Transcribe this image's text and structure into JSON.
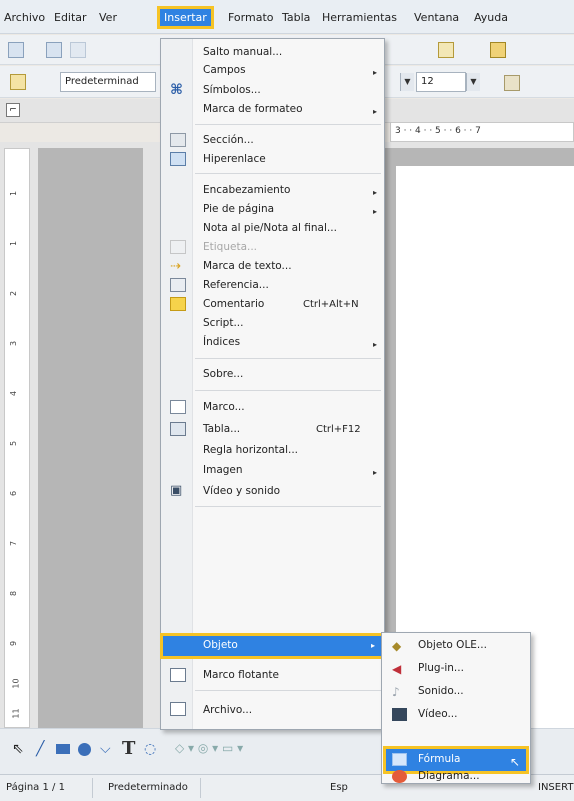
{
  "menubar": {
    "items": [
      "Archivo",
      "Editar",
      "Ver",
      "Insertar",
      "Formato",
      "Tabla",
      "Herramientas",
      "Ventana",
      "Ayuda"
    ]
  },
  "toolbar": {
    "style_value": "Predeterminad",
    "font_size_value": "12"
  },
  "hruler": {
    "text": "3 · · 4 · · 5 · · 6 · · 7"
  },
  "vruler": {
    "marks": [
      "1",
      "1",
      "2",
      "3",
      "4",
      "5",
      "6",
      "7",
      "8",
      "9",
      "10",
      "11"
    ]
  },
  "insert_menu": {
    "items": [
      {
        "label": "Salto manual...",
        "arrow": false
      },
      {
        "label": "Campos",
        "arrow": true
      },
      {
        "label": "Símbolos...",
        "arrow": false
      },
      {
        "label": "Marca de formateo",
        "arrow": true
      },
      {
        "label": "Sección...",
        "arrow": false
      },
      {
        "label": "Hiperenlace",
        "arrow": false
      },
      {
        "label": "Encabezamiento",
        "arrow": true
      },
      {
        "label": "Pie de página",
        "arrow": true
      },
      {
        "label": "Nota al pie/Nota al final...",
        "arrow": false
      },
      {
        "label": "Etiqueta...",
        "arrow": false,
        "disabled": true
      },
      {
        "label": "Marca de texto...",
        "arrow": false
      },
      {
        "label": "Referencia...",
        "arrow": false
      },
      {
        "label": "Comentario",
        "shortcut": "Ctrl+Alt+N",
        "arrow": false
      },
      {
        "label": "Script...",
        "arrow": false
      },
      {
        "label": "Índices",
        "arrow": true
      },
      {
        "label": "Sobre...",
        "arrow": false
      },
      {
        "label": "Marco...",
        "arrow": false
      },
      {
        "label": "Tabla...",
        "shortcut": "Ctrl+F12",
        "arrow": false
      },
      {
        "label": "Regla horizontal...",
        "arrow": false
      },
      {
        "label": "Imagen",
        "arrow": true
      },
      {
        "label": "Vídeo y sonido",
        "arrow": false
      },
      {
        "label": "Objeto",
        "arrow": true,
        "selected": true
      },
      {
        "label": "Marco flotante",
        "arrow": false
      },
      {
        "label": "Archivo...",
        "arrow": false
      }
    ]
  },
  "object_submenu": {
    "items": [
      "Objeto OLE...",
      "Plug-in...",
      "Sonido...",
      "Vídeo...",
      "Fórmula",
      "Diagrama..."
    ]
  },
  "statusbar": {
    "page": "Página 1 / 1",
    "style": "Predeterminado",
    "lang": "Esp",
    "mode": "INSERT"
  },
  "colors": {
    "accent": "#2f82e2",
    "highlight": "#f6c325"
  }
}
